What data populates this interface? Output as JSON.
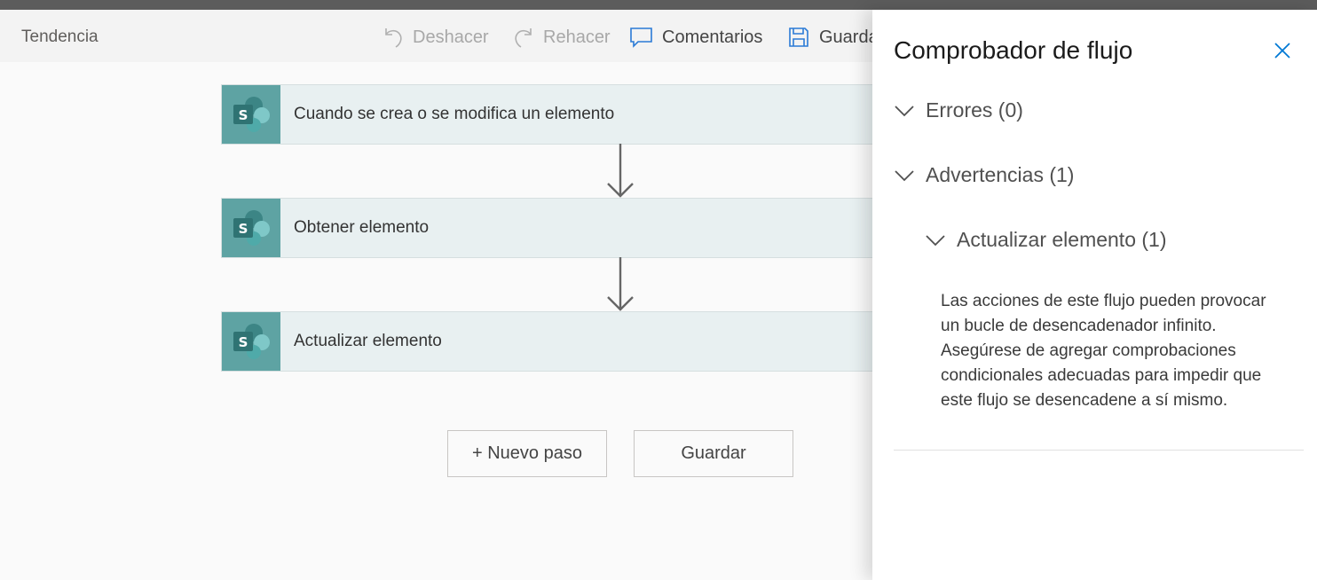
{
  "header": {
    "title": "Tendencia",
    "undo_label": "Deshacer",
    "redo_label": "Rehacer",
    "comments_label": "Comentarios",
    "save_label": "Guarda"
  },
  "flow": {
    "steps": [
      {
        "label": "Cuando se crea o se modifica un elemento",
        "icon": "sharepoint-icon"
      },
      {
        "label": "Obtener elemento",
        "icon": "sharepoint-icon"
      },
      {
        "label": "Actualizar elemento",
        "icon": "sharepoint-icon"
      }
    ],
    "new_step_label": "+ Nuevo paso",
    "save_label": "Guardar"
  },
  "checker": {
    "title": "Comprobador de flujo",
    "errors_label": "Errores (0)",
    "warnings_label": "Advertencias (1)",
    "warning_item_label": "Actualizar elemento (1)",
    "warning_text": "Las acciones de este flujo pueden provocar un bucle de desencadenador infinito. Asegúrese de agregar comprobaciones condicionales adecuadas para impedir que este flujo se desencadene a sí mismo."
  },
  "colors": {
    "sharepoint": "#5ea3a3",
    "accent": "#0078d4"
  }
}
